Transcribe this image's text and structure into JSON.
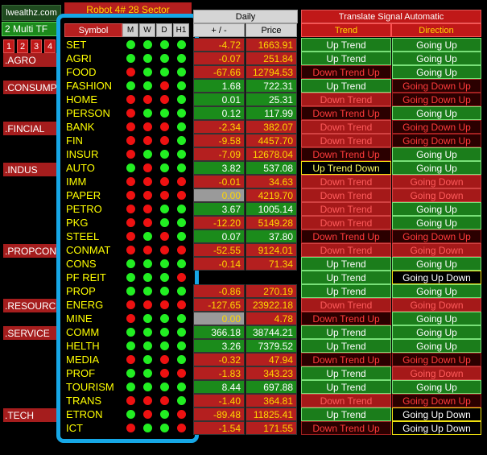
{
  "brand": "lwealthz.com",
  "timeframe": "2 Multi TF",
  "tf_buttons": [
    "1",
    "2",
    "3",
    "4"
  ],
  "robot_title": "Robot 4# 28 Sector",
  "headers": {
    "symbol": "Symbol",
    "m": "M",
    "w": "W",
    "d": "D",
    "h1": "H1",
    "daily": "Daily",
    "change": "+ / -",
    "price": "Price",
    "translate": "Translate Signal Automatic",
    "trend": "Trend",
    "direction": "Direction"
  },
  "sectors": [
    ".AGRO",
    ".CONSUMP",
    ".FINCIAL",
    ".INDUS",
    ".PROPCON",
    ".RESOURC",
    ".SERVICE",
    ".TECH"
  ],
  "colors": {
    "green": "#22ee22",
    "red": "#ee1111",
    "panel_border": "#16a7e6"
  },
  "rows": [
    {
      "symbol": "SET",
      "dots": [
        "g",
        "g",
        "g",
        "g"
      ],
      "change": "-4.72",
      "price": "1663.91",
      "trend": "Up Trend",
      "direction": "Going Up"
    },
    {
      "symbol": "AGRI",
      "dots": [
        "g",
        "g",
        "g",
        "g"
      ],
      "change": "-0.07",
      "price": "251.84",
      "trend": "Up Trend",
      "direction": "Going Up"
    },
    {
      "symbol": "FOOD",
      "dots": [
        "r",
        "g",
        "g",
        "g"
      ],
      "change": "-67.66",
      "price": "12794.53",
      "trend": "Down Trend Up",
      "direction": "Going Up"
    },
    {
      "symbol": "FASHION",
      "dots": [
        "g",
        "g",
        "r",
        "g"
      ],
      "change": "1.68",
      "price": "722.31",
      "trend": "Up Trend",
      "direction": "Going Down Up"
    },
    {
      "symbol": "HOME",
      "dots": [
        "r",
        "r",
        "r",
        "g"
      ],
      "change": "0.01",
      "price": "25.31",
      "trend": "Down Trend",
      "direction": "Going Down Up"
    },
    {
      "symbol": "PERSON",
      "dots": [
        "r",
        "g",
        "g",
        "g"
      ],
      "change": "0.12",
      "price": "117.99",
      "trend": "Down Trend Up",
      "direction": "Going Up"
    },
    {
      "symbol": "BANK",
      "dots": [
        "r",
        "r",
        "r",
        "g"
      ],
      "change": "-2.34",
      "price": "382.07",
      "trend": "Down Trend",
      "direction": "Going Down Up"
    },
    {
      "symbol": "FIN",
      "dots": [
        "r",
        "r",
        "r",
        "g"
      ],
      "change": "-9.58",
      "price": "4457.70",
      "trend": "Down Trend",
      "direction": "Going Down Up"
    },
    {
      "symbol": "INSUR",
      "dots": [
        "r",
        "g",
        "g",
        "g"
      ],
      "change": "-7.09",
      "price": "12678.04",
      "trend": "Down Trend Up",
      "direction": "Going Up"
    },
    {
      "symbol": "AUTO",
      "dots": [
        "g",
        "r",
        "g",
        "g"
      ],
      "change": "3.82",
      "price": "537.08",
      "trend": "Up Trend Down",
      "direction": "Going Up"
    },
    {
      "symbol": "IMM",
      "dots": [
        "r",
        "r",
        "r",
        "r"
      ],
      "change": "-0.01",
      "price": "34.63",
      "trend": "Down Trend",
      "direction": "Going Down"
    },
    {
      "symbol": "PAPER",
      "dots": [
        "r",
        "r",
        "r",
        "r"
      ],
      "change": "0.00",
      "price": "4219.70",
      "trend": "Down Trend",
      "direction": "Going Down"
    },
    {
      "symbol": "PETRO",
      "dots": [
        "r",
        "r",
        "g",
        "g"
      ],
      "change": "3.67",
      "price": "1005.14",
      "trend": "Down Trend",
      "direction": "Going Up"
    },
    {
      "symbol": "PKG",
      "dots": [
        "r",
        "r",
        "g",
        "g"
      ],
      "change": "-12.20",
      "price": "5149.28",
      "trend": "Down Trend",
      "direction": "Going Up"
    },
    {
      "symbol": "STEEL",
      "dots": [
        "r",
        "g",
        "r",
        "g"
      ],
      "change": "0.07",
      "price": "37.80",
      "trend": "Down Trend Up",
      "direction": "Going Down Up"
    },
    {
      "symbol": "CONMAT",
      "dots": [
        "r",
        "r",
        "r",
        "r"
      ],
      "change": "-52.55",
      "price": "9124.01",
      "trend": "Down Trend",
      "direction": "Going Down"
    },
    {
      "symbol": "CONS",
      "dots": [
        "g",
        "g",
        "g",
        "g"
      ],
      "change": "-0.14",
      "price": "71.34",
      "trend": "Up Trend",
      "direction": "Going Up"
    },
    {
      "symbol": "PF REIT",
      "dots": [
        "g",
        "g",
        "g",
        "r"
      ],
      "change": "",
      "price": "",
      "trend": "Up Trend",
      "direction": "Going Up Down"
    },
    {
      "symbol": "PROP",
      "dots": [
        "g",
        "g",
        "g",
        "g"
      ],
      "change": "-0.86",
      "price": "270.19",
      "trend": "Up Trend",
      "direction": "Going Up"
    },
    {
      "symbol": "ENERG",
      "dots": [
        "r",
        "r",
        "r",
        "r"
      ],
      "change": "-127.65",
      "price": "23922.18",
      "trend": "Down Trend",
      "direction": "Going Down"
    },
    {
      "symbol": "MINE",
      "dots": [
        "r",
        "g",
        "g",
        "g"
      ],
      "change": "0.00",
      "price": "4.78",
      "trend": "Down Trend Up",
      "direction": "Going Up"
    },
    {
      "symbol": "COMM",
      "dots": [
        "g",
        "g",
        "g",
        "g"
      ],
      "change": "366.18",
      "price": "38744.21",
      "trend": "Up Trend",
      "direction": "Going Up"
    },
    {
      "symbol": "HELTH",
      "dots": [
        "g",
        "g",
        "g",
        "g"
      ],
      "change": "3.26",
      "price": "7379.52",
      "trend": "Up Trend",
      "direction": "Going Up"
    },
    {
      "symbol": "MEDIA",
      "dots": [
        "r",
        "g",
        "r",
        "g"
      ],
      "change": "-0.32",
      "price": "47.94",
      "trend": "Down Trend Up",
      "direction": "Going Down Up"
    },
    {
      "symbol": "PROF",
      "dots": [
        "g",
        "g",
        "r",
        "r"
      ],
      "change": "-1.83",
      "price": "343.23",
      "trend": "Up Trend",
      "direction": "Going Down"
    },
    {
      "symbol": "TOURISM",
      "dots": [
        "g",
        "g",
        "g",
        "g"
      ],
      "change": "8.44",
      "price": "697.88",
      "trend": "Up Trend",
      "direction": "Going Up"
    },
    {
      "symbol": "TRANS",
      "dots": [
        "r",
        "r",
        "r",
        "g"
      ],
      "change": "-1.40",
      "price": "364.81",
      "trend": "Down Trend",
      "direction": "Going Down Up"
    },
    {
      "symbol": "ETRON",
      "dots": [
        "g",
        "r",
        "g",
        "r"
      ],
      "change": "-89.48",
      "price": "11825.41",
      "trend": "Up Trend",
      "direction": "Going Up Down"
    },
    {
      "symbol": "ICT",
      "dots": [
        "r",
        "g",
        "g",
        "r"
      ],
      "change": "-1.54",
      "price": "171.55",
      "trend": "Down Trend Up",
      "direction": "Going Up Down"
    }
  ]
}
